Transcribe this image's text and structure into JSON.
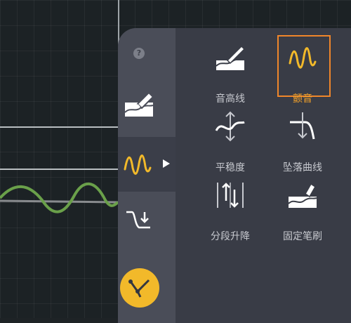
{
  "panel": {
    "help_glyph": "?",
    "side_items": [
      {
        "icon": "pencil-brush-icon"
      },
      {
        "icon": "vibrato-wave-icon",
        "active": true
      },
      {
        "icon": "pitch-drop-icon"
      }
    ],
    "tools": [
      {
        "label": "音高线",
        "icon": "pitch-line-icon"
      },
      {
        "label": "颤音",
        "icon": "vibrato-icon",
        "selected": true
      },
      {
        "label": "平稳度",
        "icon": "smoothness-icon"
      },
      {
        "label": "坠落曲线",
        "icon": "falloff-curve-icon"
      },
      {
        "label": "分段升降",
        "icon": "segment-raise-lower-icon"
      },
      {
        "label": "固定笔刷",
        "icon": "fixed-brush-icon"
      }
    ],
    "accent_color": "#f2b92a",
    "selection_color": "#f0862a"
  }
}
